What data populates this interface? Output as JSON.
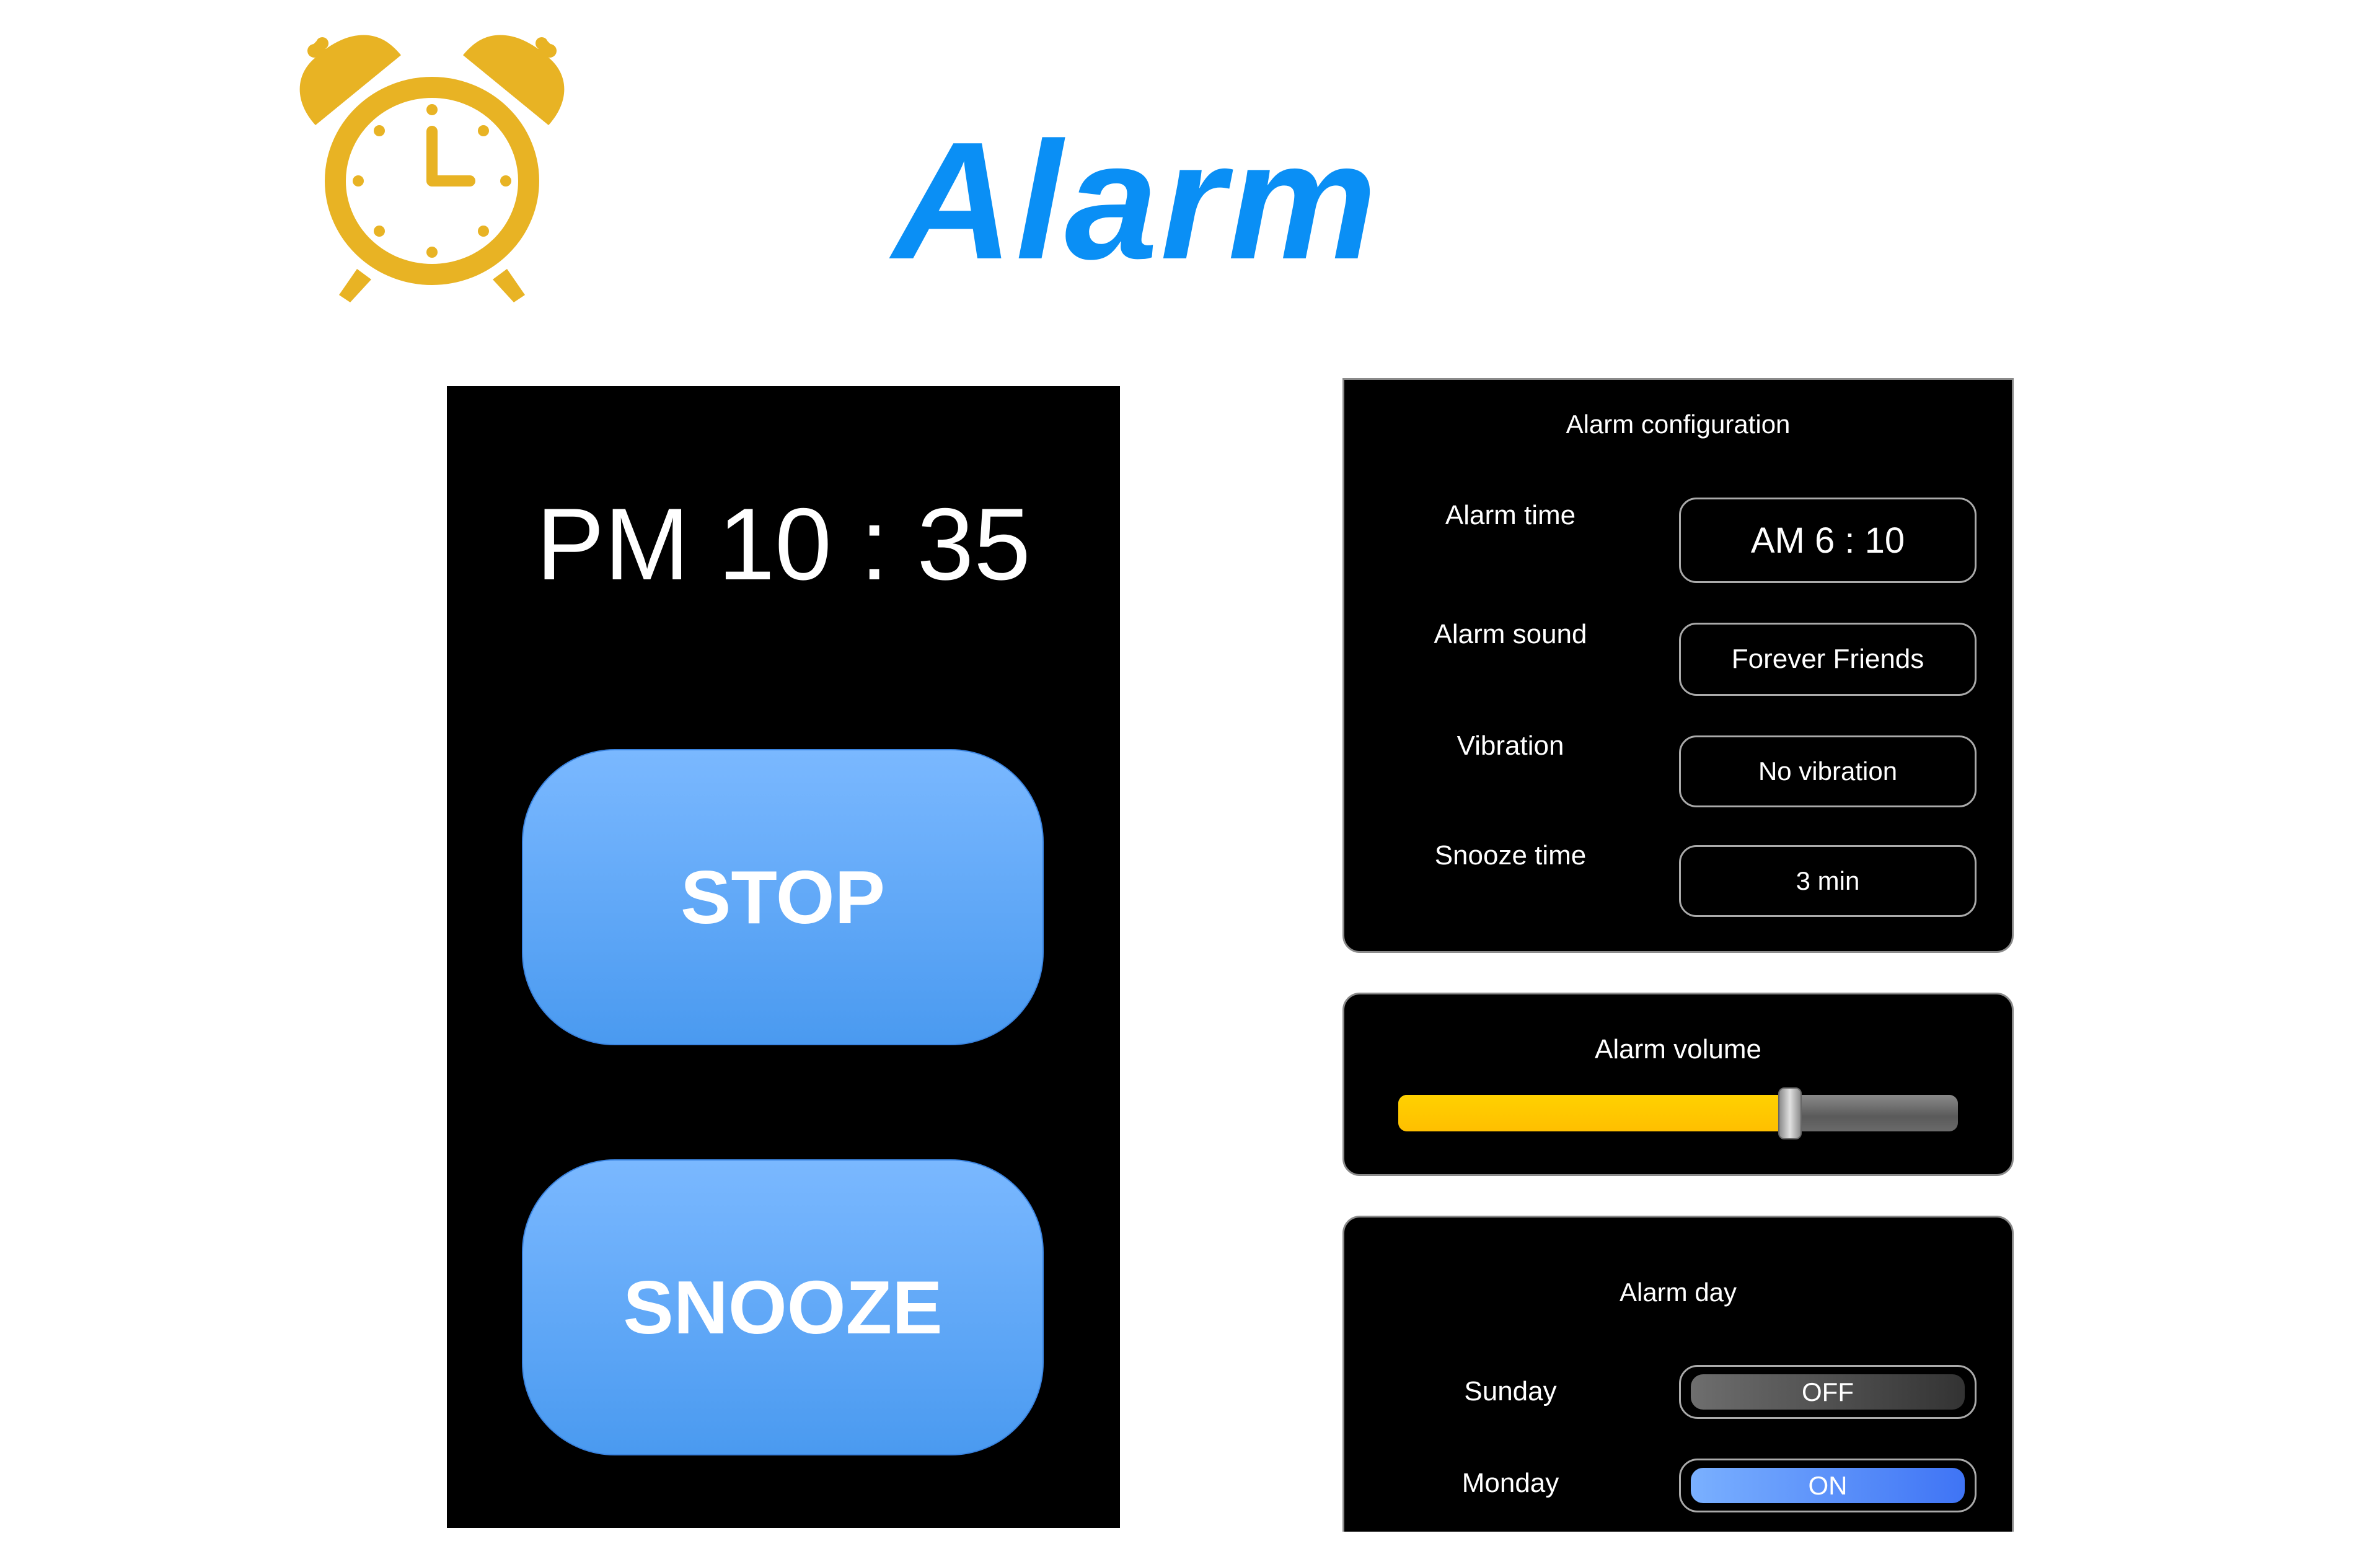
{
  "header": {
    "title": "Alarm",
    "icon": "alarm-clock-icon",
    "icon_color": "#e8b324",
    "title_color": "#0a8ff5"
  },
  "alarm_screen": {
    "current_time": "PM 10 : 35",
    "stop_label": "STOP",
    "snooze_label": "SNOOZE",
    "button_color": "#5fa8f7"
  },
  "config": {
    "title": "Alarm configuration",
    "rows": [
      {
        "label": "Alarm time",
        "value": "AM 6 : 10"
      },
      {
        "label": "Alarm sound",
        "value": "Forever Friends"
      },
      {
        "label": "Vibration",
        "value": "No vibration"
      },
      {
        "label": "Snooze time",
        "value": "3 min"
      }
    ]
  },
  "volume": {
    "title": "Alarm volume",
    "level_percent": 70,
    "fill_color": "#ffc400"
  },
  "days": {
    "title": "Alarm day",
    "items": [
      {
        "label": "Sunday",
        "state": "OFF"
      },
      {
        "label": "Monday",
        "state": "ON"
      }
    ]
  }
}
